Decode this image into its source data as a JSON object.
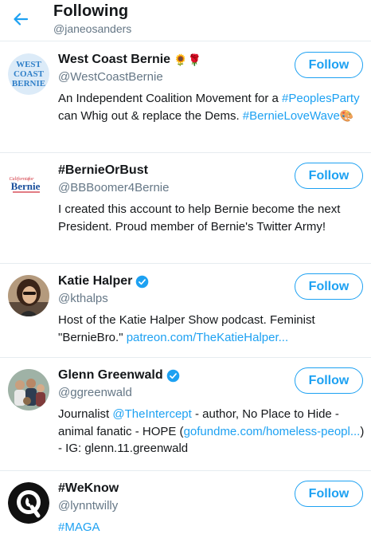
{
  "header": {
    "title": "Following",
    "subtitle": "@janeosanders"
  },
  "colors": {
    "accent": "#1da1f2",
    "secondary_text": "#657786",
    "divider": "#e6ecf0"
  },
  "users": [
    {
      "avatar_icon": "west-coast-bernie-logo",
      "avatar_text": [
        "WEST",
        "COAST",
        "BERNIE"
      ],
      "name": "West Coast Bernie",
      "name_emoji": "🌻🌹",
      "verified": false,
      "handle": "@WestCoastBernie",
      "follow_label": "Follow",
      "bio": {
        "t1": "An Independent Coalition Movement for a ",
        "l1": "#PeoplesParty",
        "t2": " can Whig out & replace the Dems. ",
        "l2": "#BernieLoveWave",
        "emoji": "🎨"
      }
    },
    {
      "avatar_icon": "bernie-logo",
      "avatar_text": [
        "California",
        "for",
        "Bernie"
      ],
      "name": "#BernieOrBust",
      "verified": false,
      "handle": "@BBBoomer4Bernie",
      "follow_label": "Follow",
      "bio": {
        "t1": "I created this account to help Bernie become the next President. Proud member of Bernie's Twitter Army!"
      }
    },
    {
      "avatar_icon": "person-photo",
      "name": "Katie Halper",
      "verified": true,
      "handle": "@kthalps",
      "follow_label": "Follow",
      "bio": {
        "t1": "Host of the Katie Halper Show podcast. Feminist \"BernieBro.\" ",
        "l1": "patreon.com/TheKatieHalper..."
      }
    },
    {
      "avatar_icon": "group-photo",
      "name": "Glenn Greenwald",
      "verified": true,
      "handle": "@ggreenwald",
      "follow_label": "Follow",
      "bio": {
        "t1": "Journalist ",
        "l1": "@TheIntercept",
        "t2": " - author, No Place to Hide - animal fanatic - HOPE (",
        "l2": "gofundme.com/homeless-peopl...",
        "t3": ") - IG: glenn.11.greenwald"
      }
    },
    {
      "avatar_icon": "q-logo",
      "name": "#WeKnow",
      "verified": false,
      "handle": "@lynntwilly",
      "follow_label": "Follow",
      "bio": {
        "l1": "#MAGA"
      }
    }
  ]
}
